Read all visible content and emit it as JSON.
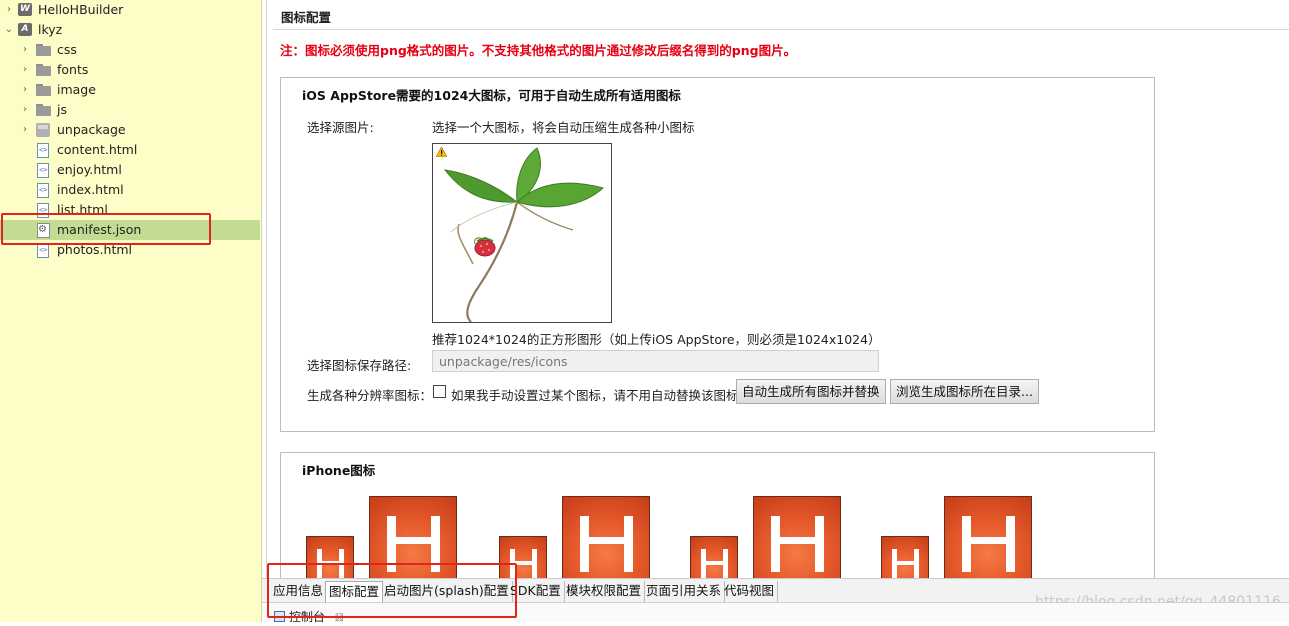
{
  "project_tree": {
    "items": [
      {
        "label": "HelloHBuilder",
        "kind": "project",
        "project_letter": "W",
        "expanded": false,
        "level": 0
      },
      {
        "label": "lkyz",
        "kind": "project",
        "project_letter": "A",
        "expanded": true,
        "level": 0
      },
      {
        "label": "css",
        "kind": "folder",
        "expanded": false,
        "level": 1
      },
      {
        "label": "fonts",
        "kind": "folder",
        "expanded": false,
        "level": 1
      },
      {
        "label": "image",
        "kind": "folder",
        "expanded": false,
        "level": 1
      },
      {
        "label": "js",
        "kind": "folder",
        "expanded": false,
        "level": 1
      },
      {
        "label": "unpackage",
        "kind": "package",
        "expanded": false,
        "level": 1
      },
      {
        "label": "content.html",
        "kind": "html",
        "level": 1
      },
      {
        "label": "enjoy.html",
        "kind": "html",
        "level": 1
      },
      {
        "label": "index.html",
        "kind": "html",
        "level": 1
      },
      {
        "label": "list.html",
        "kind": "html",
        "level": 1
      },
      {
        "label": "manifest.json",
        "kind": "json",
        "level": 1,
        "selected": true
      },
      {
        "label": "photos.html",
        "kind": "html",
        "level": 1
      }
    ]
  },
  "editor": {
    "title": "图标配置",
    "note": "注：图标必须使用png格式的图片。不支持其他格式的图片通过修改后缀名得到的png图片。",
    "ios_group": {
      "title": "iOS AppStore需要的1024大图标，可用于自动生成所有适用图标",
      "source_label": "选择源图片:",
      "source_hint": "选择一个大图标，将会自动压缩生成各种小图标",
      "recommend_text": "推荐1024*1024的正方形图形（如上传iOS AppStore，则必须是1024x1024）",
      "save_path_label": "选择图标保存路径:",
      "save_path_value": "unpackage/res/icons",
      "generate_label": "生成各种分辨率图标：",
      "checkbox_label": "如果我手动设置过某个图标，请不用自动替换该图标",
      "checkbox_checked": false,
      "auto_generate_button": "自动生成所有图标并替换",
      "browse_button": "浏览生成图标所在目录..."
    },
    "iphone_group": {
      "title": "iPhone图标",
      "icon_count": 8,
      "icon_letter": "H"
    }
  },
  "bottom_tabs": {
    "items": [
      "应用信息",
      "图标配置",
      "启动图片(splash)配置",
      "SDK配置",
      "模块权限配置",
      "页面引用关系",
      "代码视图"
    ],
    "active_index": 1
  },
  "watermark": "https://blog.csdn.net/qq_44801116",
  "console": {
    "label": "控制台",
    "close_glyph": "☒"
  },
  "colors": {
    "sidebar_bg": "#fdfdc8",
    "selected_row": "#c2dc94",
    "note_red": "#e60012",
    "highlight_red": "#e1251b",
    "icon_orange": "#e65a2c"
  }
}
